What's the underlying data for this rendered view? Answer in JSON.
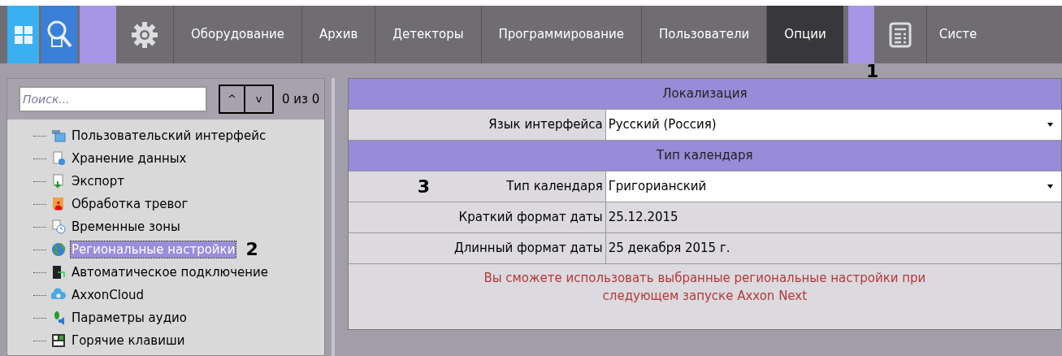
{
  "toolbar": {
    "tabs": [
      {
        "label": "Оборудование",
        "selected": false
      },
      {
        "label": "Архив",
        "selected": false
      },
      {
        "label": "Детекторы",
        "selected": false
      },
      {
        "label": "Программирование",
        "selected": false
      },
      {
        "label": "Пользователи",
        "selected": false
      },
      {
        "label": "Опции",
        "selected": true
      }
    ],
    "cut_tab": "Систе"
  },
  "callouts": [
    "1",
    "2",
    "3"
  ],
  "sidebar": {
    "search": {
      "placeholder": "Поиск..."
    },
    "up": "^",
    "down": "v",
    "match_count": "0 из 0",
    "items": [
      {
        "label": "Пользовательский интерфейс",
        "kind": "window",
        "selected": false
      },
      {
        "label": "Хранение данных",
        "kind": "storage",
        "selected": false
      },
      {
        "label": "Экспорт",
        "kind": "export",
        "selected": false
      },
      {
        "label": "Обработка тревог",
        "kind": "alarm",
        "selected": false
      },
      {
        "label": "Временные зоны",
        "kind": "clock",
        "selected": false
      },
      {
        "label": "Региональные настройки",
        "kind": "globe",
        "selected": true
      },
      {
        "label": "Автоматическое подключение",
        "kind": "server",
        "selected": false
      },
      {
        "label": "AxxonCloud",
        "kind": "cloud",
        "selected": false
      },
      {
        "label": "Параметры аудио",
        "kind": "audio",
        "selected": false
      },
      {
        "label": "Горячие клавиши",
        "kind": "keys",
        "selected": false
      }
    ]
  },
  "settings": {
    "rows": [
      {
        "kind": "header",
        "label": "Локализация"
      },
      {
        "kind": "select",
        "label": "Язык интерфейса",
        "value": "Русский (Россия)"
      },
      {
        "kind": "header",
        "label": "Тип календаря"
      },
      {
        "kind": "select",
        "label": "Тип календаря",
        "value": "Григорианский"
      },
      {
        "kind": "text",
        "label": "Краткий формат даты",
        "value": "25.12.2015"
      },
      {
        "kind": "text",
        "label": "Длинный формат даты",
        "value": "25 декабря 2015 г."
      }
    ],
    "notice": "Вы сможете использовать выбранные региональные настройки при следующем запуске Axxon Next"
  }
}
